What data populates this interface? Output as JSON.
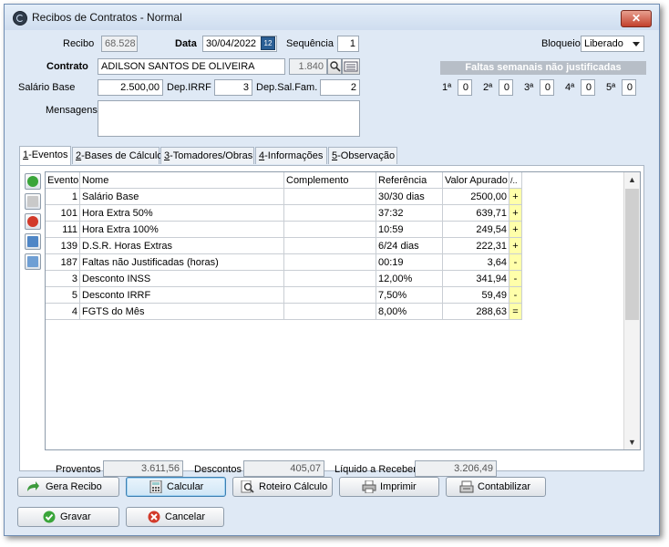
{
  "window": {
    "title": "Recibos de Contratos - Normal",
    "close_label": "✕"
  },
  "header": {
    "recibo_label": "Recibo",
    "recibo_value": "68.528",
    "data_label": "Data",
    "data_value": "30/04/2022",
    "calendar_label": "12",
    "sequencia_label": "Sequência",
    "sequencia_value": "1",
    "bloqueio_label": "Bloqueio",
    "bloqueio_value": "Liberado",
    "contrato_label": "Contrato",
    "contrato_value": "ADILSON SANTOS DE OLIVEIRA",
    "contrato_code": "1.840",
    "salario_label": "Salário Base",
    "salario_value": "2.500,00",
    "depirrf_label": "Dep.IRRF",
    "depirrf_value": "3",
    "depsalfam_label": "Dep.Sal.Fam.",
    "depsalfam_value": "2",
    "mensagens_label": "Mensagens",
    "mensagens_value": ""
  },
  "faltas": {
    "title": "Faltas semanais não justificadas",
    "weeks": [
      {
        "label": "1ª",
        "value": "0"
      },
      {
        "label": "2ª",
        "value": "0"
      },
      {
        "label": "3ª",
        "value": "0"
      },
      {
        "label": "4ª",
        "value": "0"
      },
      {
        "label": "5ª",
        "value": "0"
      }
    ]
  },
  "tabs": [
    {
      "key": "1",
      "label": "-Eventos"
    },
    {
      "key": "2",
      "label": "-Bases de Cálculo"
    },
    {
      "key": "3",
      "label": "-Tomadores/Obras"
    },
    {
      "key": "4",
      "label": "-Informações"
    },
    {
      "key": "5",
      "label": "-Observação"
    }
  ],
  "grid": {
    "columns": [
      "Evento",
      "Nome",
      "Complemento",
      "Referência",
      "Valor Apurado",
      "/.."
    ],
    "rows": [
      {
        "evento": "1",
        "nome": "Salário Base",
        "complemento": "",
        "referencia": "30/30 dias",
        "valor": "2500,00",
        "sinal": "+"
      },
      {
        "evento": "101",
        "nome": "Hora Extra 50%",
        "complemento": "",
        "referencia": "37:32",
        "valor": "639,71",
        "sinal": "+"
      },
      {
        "evento": "111",
        "nome": "Hora Extra 100%",
        "complemento": "",
        "referencia": "10:59",
        "valor": "249,54",
        "sinal": "+"
      },
      {
        "evento": "139",
        "nome": "D.S.R. Horas Extras",
        "complemento": "",
        "referencia": "6/24 dias",
        "valor": "222,31",
        "sinal": "+"
      },
      {
        "evento": "187",
        "nome": "Faltas não Justificadas (horas)",
        "complemento": "",
        "referencia": "00:19",
        "valor": "3,64",
        "sinal": "-"
      },
      {
        "evento": "3",
        "nome": "Desconto INSS",
        "complemento": "",
        "referencia": "12,00%",
        "valor": "341,94",
        "sinal": "-"
      },
      {
        "evento": "5",
        "nome": "Desconto IRRF",
        "complemento": "",
        "referencia": "7,50%",
        "valor": "59,49",
        "sinal": "-"
      },
      {
        "evento": "4",
        "nome": "FGTS do Mês",
        "complemento": "",
        "referencia": "8,00%",
        "valor": "288,63",
        "sinal": "="
      }
    ]
  },
  "totals": {
    "proventos_label": "Proventos",
    "proventos_value": "3.611,56",
    "descontos_label": "Descontos",
    "descontos_value": "405,07",
    "liquido_label": "Líquido a Receber",
    "liquido_value": "3.206,49"
  },
  "buttons": {
    "gera_recibo": "Gera Recibo",
    "calcular": "Calcular",
    "roteiro": "Roteiro Cálculo",
    "imprimir": "Imprimir",
    "contabilizar": "Contabilizar",
    "gravar": "Gravar",
    "cancelar": "Cancelar"
  },
  "colors": {
    "accent": "#3c7fb1",
    "sign_bg": "#ffffaa",
    "faltas_bg": "#b7bec7"
  }
}
